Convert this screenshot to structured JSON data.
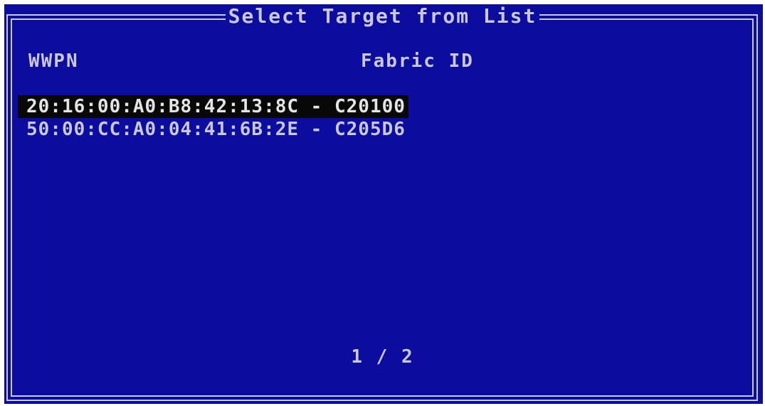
{
  "dialog": {
    "title": "Select Target from List"
  },
  "columns": {
    "wwpn": "WWPN",
    "fabric_id": "Fabric ID"
  },
  "targets": [
    {
      "text": "20:16:00:A0:B8:42:13:8C - C20100",
      "selected": true
    },
    {
      "text": "50:00:CC:A0:04:41:6B:2E - C205D6",
      "selected": false
    }
  ],
  "pager": {
    "text": "1 / 2"
  },
  "colors": {
    "background": "#0c0c9e",
    "text": "#c8c8d8",
    "selection": "#080808"
  }
}
